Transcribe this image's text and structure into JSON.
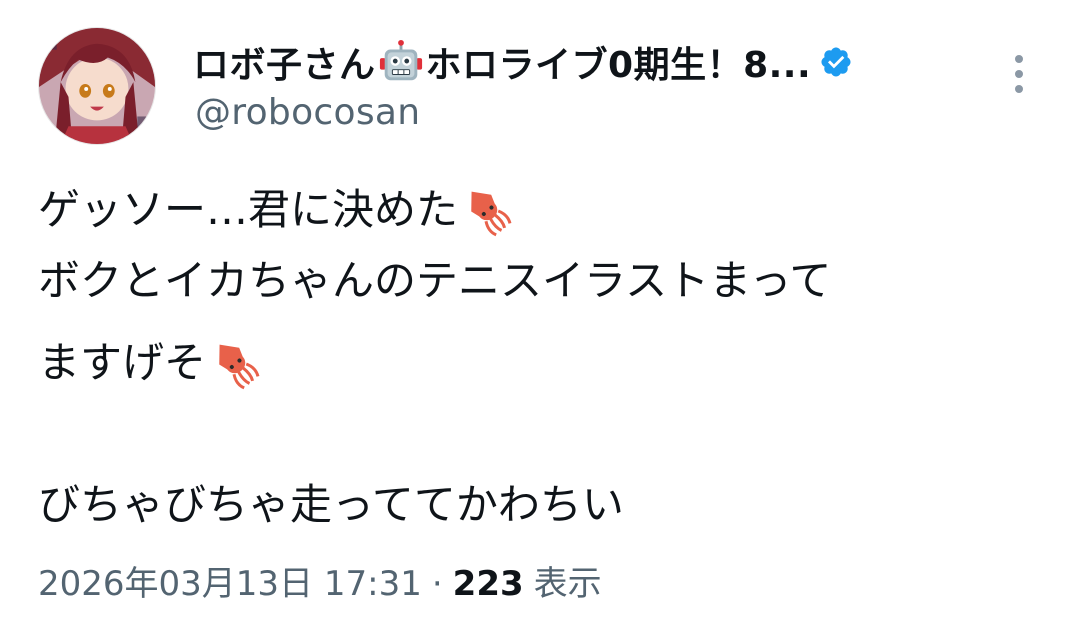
{
  "author": {
    "display_name_part1": "ロボ子さん",
    "display_name_part2": "ホロライブ0期生！8...",
    "handle": "@robocosan",
    "verified": true
  },
  "icons": {
    "name_emoji": "robot-icon",
    "verified": "verified-badge-icon",
    "more": "more-vertical-icon",
    "text_emoji": "squid-icon"
  },
  "tweet": {
    "lines": [
      "ゲッソー…君に決めた",
      "ボクとイカちゃんのテニスイラストまって",
      "ますげそ",
      "",
      "びちゃびちゃ走っててかわちい"
    ]
  },
  "meta": {
    "timestamp": "2026年03月13日 17:31",
    "separator": "·",
    "views_count": "223",
    "views_label": "表示"
  },
  "colors": {
    "text": "#0f1419",
    "secondary": "#536471",
    "verified": "#1d9bf0"
  }
}
